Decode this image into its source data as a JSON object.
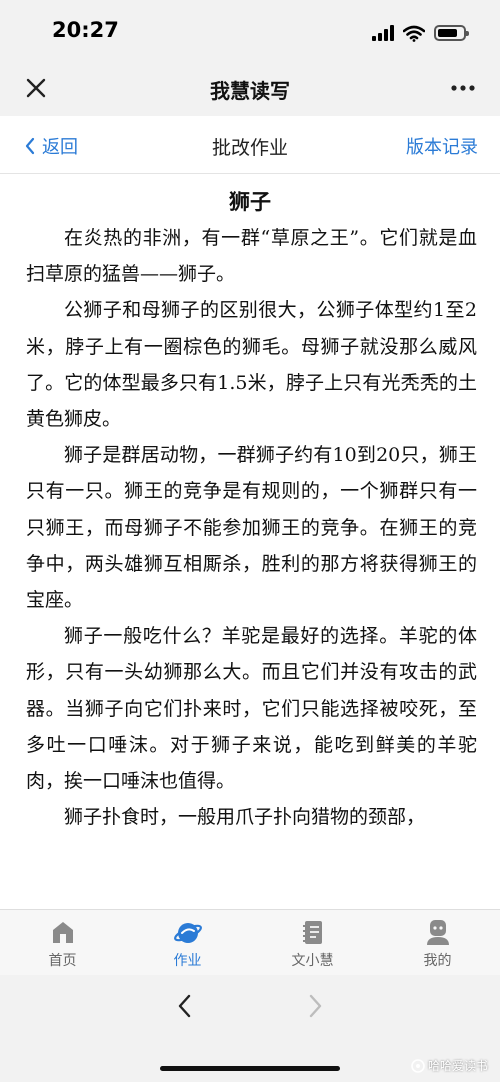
{
  "status_bar": {
    "time": "20:27"
  },
  "app_bar": {
    "title": "我慧读写"
  },
  "sub_nav": {
    "back_label": "返回",
    "title": "批改作业",
    "version_label": "版本记录"
  },
  "essay": {
    "title": "狮子",
    "paragraphs": [
      "在炎热的非洲，有一群“草原之王”。它们就是血扫草原的猛兽——狮子。",
      "公狮子和母狮子的区别很大，公狮子体型约1至2米，脖子上有一圈棕色的狮毛。母狮子就没那么威风了。它的体型最多只有1.5米，脖子上只有光秃秃的土黄色狮皮。",
      "狮子是群居动物，一群狮子约有10到20只，狮王只有一只。狮王的竞争是有规则的，一个狮群只有一只狮王，而母狮子不能参加狮王的竞争。在狮王的竞争中，两头雄狮互相厮杀，胜利的那方将获得狮王的宝座。",
      "狮子一般吃什么？羊驼是最好的选择。羊驼的体形，只有一头幼狮那么大。而且它们并没有攻击的武器。当狮子向它们扑来时，它们只能选择被咬死，至多吐一口唾沫。对于狮子来说，能吃到鲜美的羊驼肉，挨一口唾沫也值得。",
      "狮子扑食时，一般用爪子扑向猎物的颈部，"
    ]
  },
  "tabs": [
    {
      "label": "首页",
      "icon": "home-icon",
      "active": false
    },
    {
      "label": "作业",
      "icon": "homework-icon",
      "active": true
    },
    {
      "label": "文小慧",
      "icon": "notebook-icon",
      "active": false
    },
    {
      "label": "我的",
      "icon": "profile-icon",
      "active": false
    }
  ],
  "watermark": "哈哈爱读书",
  "colors": {
    "accent": "#2b7bd6",
    "bar_background": "#f2f2f2",
    "tab_icon_inactive": "#888888"
  }
}
